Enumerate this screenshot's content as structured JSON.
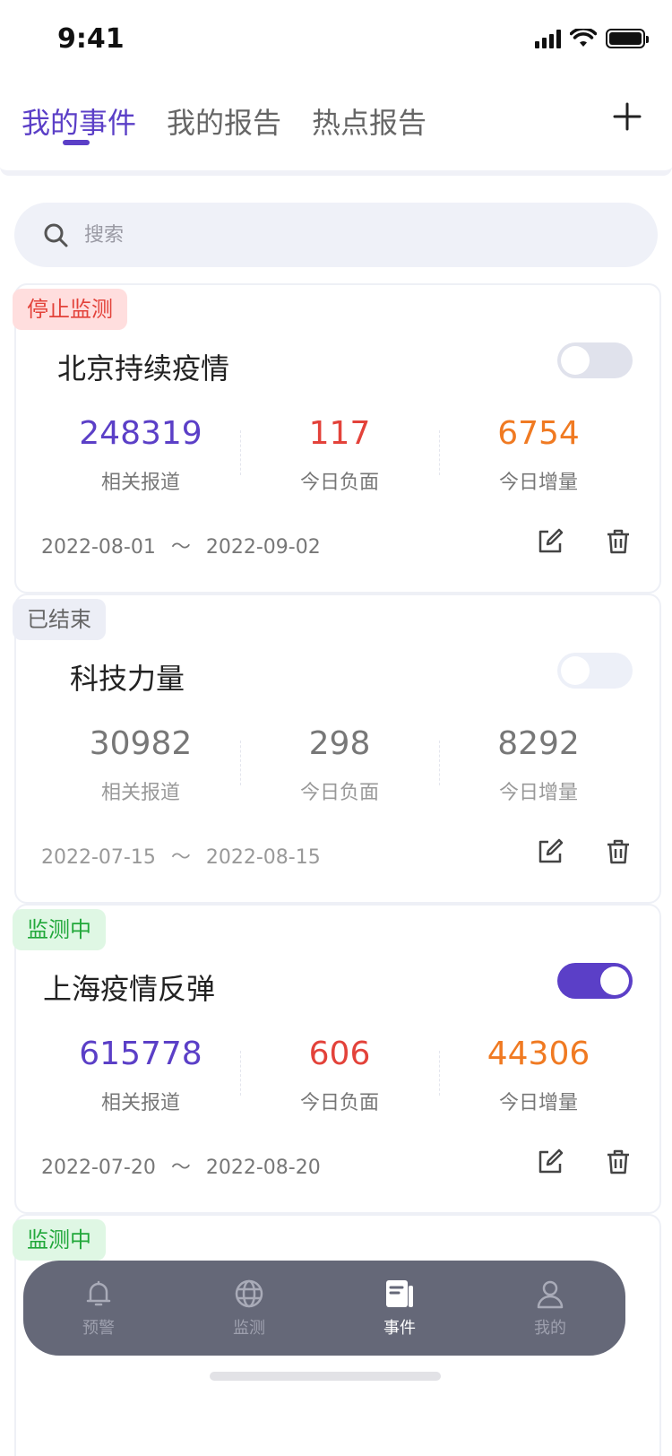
{
  "status_bar": {
    "time": "9:41"
  },
  "tabs": [
    {
      "label": "我的事件",
      "active": true
    },
    {
      "label": "我的报告",
      "active": false
    },
    {
      "label": "热点报告",
      "active": false
    }
  ],
  "header": {
    "add_icon": "plus-icon"
  },
  "search": {
    "placeholder": "搜索"
  },
  "events": [
    {
      "status": "停止监测",
      "title": "北京持续疫情",
      "toggle_on": false,
      "stats": [
        {
          "value": "248319",
          "label": "相关报道"
        },
        {
          "value": "117",
          "label": "今日负面"
        },
        {
          "value": "6754",
          "label": "今日增量"
        }
      ],
      "start_date": "2022-08-01",
      "separator": "～",
      "end_date": "2022-09-02"
    },
    {
      "status": "已结束",
      "title": "科技力量",
      "toggle_on": false,
      "stats": [
        {
          "value": "30982",
          "label": "相关报道"
        },
        {
          "value": "298",
          "label": "今日负面"
        },
        {
          "value": "8292",
          "label": "今日增量"
        }
      ],
      "start_date": "2022-07-15",
      "separator": "～",
      "end_date": "2022-08-15"
    },
    {
      "status": "监测中",
      "title": "上海疫情反弹",
      "toggle_on": true,
      "stats": [
        {
          "value": "615778",
          "label": "相关报道"
        },
        {
          "value": "606",
          "label": "今日负面"
        },
        {
          "value": "44306",
          "label": "今日增量"
        }
      ],
      "start_date": "2022-07-20",
      "separator": "～",
      "end_date": "2022-08-20"
    },
    {
      "status": "监测中"
    }
  ],
  "bottom_nav": [
    {
      "label": "预警",
      "icon": "bell-icon",
      "active": false
    },
    {
      "label": "监测",
      "icon": "globe-icon",
      "active": false
    },
    {
      "label": "事件",
      "icon": "document-icon",
      "active": true
    },
    {
      "label": "我的",
      "icon": "user-icon",
      "active": false
    }
  ],
  "colors": {
    "accent": "#5b3fc7",
    "negative": "#e3423a",
    "increment": "#f07a22",
    "monitoring": "#21a83a",
    "nav_bg": "#656878"
  }
}
